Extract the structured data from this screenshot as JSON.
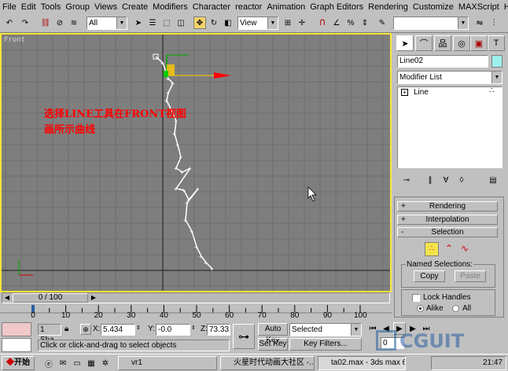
{
  "menu": [
    "File",
    "Edit",
    "Tools",
    "Group",
    "Views",
    "Create",
    "Modifiers",
    "Character",
    "reactor",
    "Animation",
    "Graph Editors",
    "Rendering",
    "Customize",
    "MAXScript",
    "Help"
  ],
  "toolbar": {
    "selection_filter": "All",
    "reference_coord": "View"
  },
  "viewport": {
    "label": "Front",
    "annotation_line1": "选择LINE工具在FRONT视图",
    "annotation_line2": "画所示曲线",
    "colors": {
      "background": "#7e7e7e",
      "grid": "#6e6e6e",
      "axis": "#1a1a1a",
      "border": "#f7e73c",
      "annotation": "#ff0000",
      "curve": "#ffffff"
    }
  },
  "panel": {
    "object_name": "Line02",
    "modifier_list": "Modifier List",
    "stack_item": "Line",
    "rollouts": [
      "Rendering",
      "Interpolation",
      "Selection"
    ],
    "named_selections": "Named Selections:",
    "copy": "Copy",
    "paste": "Paste",
    "lock_handles": "Lock Handles",
    "alike": "Alike",
    "all": "All"
  },
  "timeline": {
    "frame_display": "0 / 100",
    "ticks": [
      "0",
      "10",
      "20",
      "30",
      "40",
      "50",
      "60",
      "70",
      "80",
      "90",
      "100"
    ]
  },
  "status": {
    "selected_count": "1 Sha",
    "x_label": "X:",
    "x_value": "5.434",
    "y_label": "Y:",
    "y_value": "-0.0",
    "z_label": "Z:",
    "z_value": "73.33",
    "auto_key": "Auto Key",
    "set_key": "Set Key",
    "key_mode": "Selected",
    "key_filters": "Key Filters...",
    "frame_field": "0",
    "prompt": "Click or click-and-drag to select objects"
  },
  "taskbar": {
    "start": "开始",
    "items": [
      "vr1",
      "火星时代动画大社区 -...",
      "ta02.max - 3ds max 6"
    ],
    "clock": "21:47"
  },
  "watermark": "CGUIT"
}
